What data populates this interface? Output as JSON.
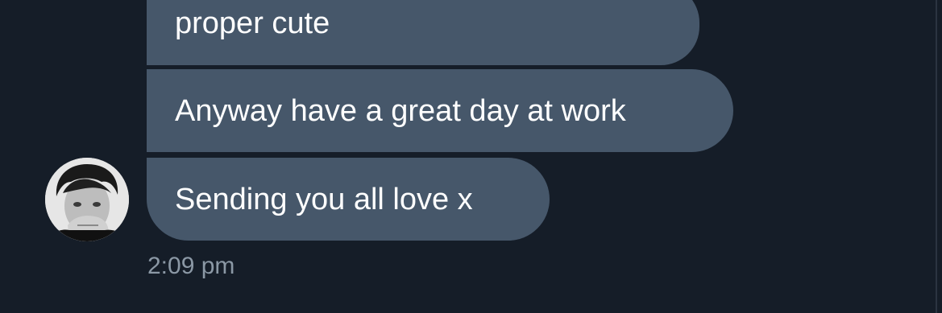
{
  "conversation": {
    "messages": [
      {
        "text": "proper cute"
      },
      {
        "text": "Anyway have a great day at work"
      },
      {
        "text": "Sending you all love x"
      }
    ],
    "timestamp": "2:09 pm"
  },
  "icons": {
    "avatar": "user-avatar"
  },
  "colors": {
    "background": "#151d28",
    "bubble": "#46576a",
    "text": "#ffffff",
    "timestamp": "#8b98a5"
  }
}
